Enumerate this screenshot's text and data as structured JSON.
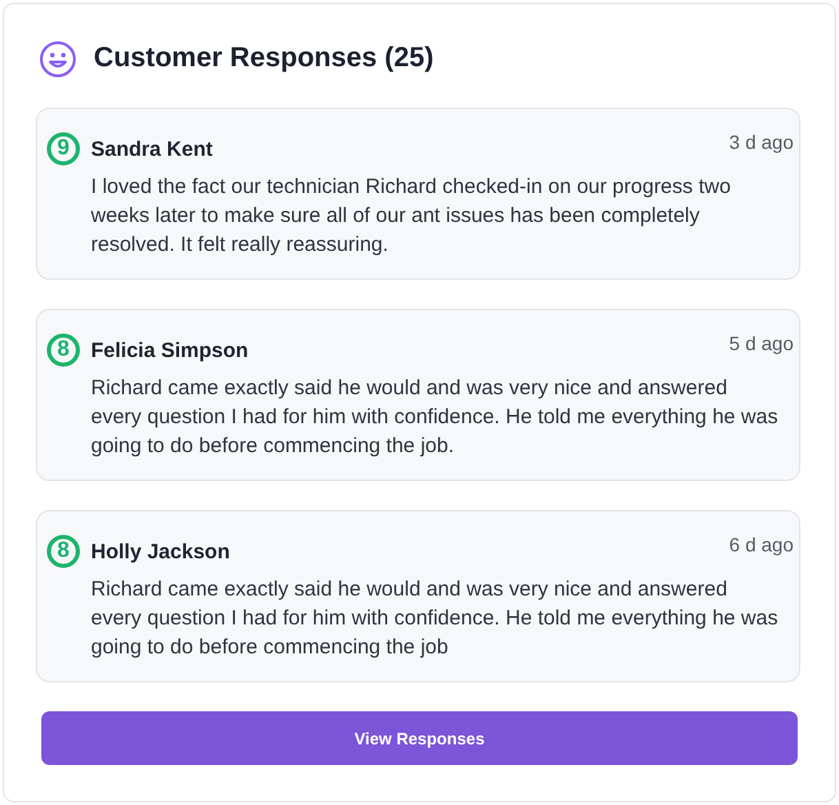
{
  "header": {
    "title": "Customer Responses (25)"
  },
  "responses": [
    {
      "score": "9",
      "name": "Sandra Kent",
      "time": "3 d ago",
      "text": "I loved the fact our technician Richard checked-in on our progress two weeks later to make sure all of our ant issues has been completely resolved. It felt really reassuring."
    },
    {
      "score": "8",
      "name": "Felicia Simpson",
      "time": "5 d ago",
      "text": "Richard came exactly said he would and was very nice and answered every question I had for him with confidence. He told me everything he was going to do before commencing the job."
    },
    {
      "score": "8",
      "name": "Holly Jackson",
      "time": "6 d ago",
      "text": "Richard came exactly said he would and was very nice and answered every question I had for him with confidence. He told me everything he was going to do before commencing the job"
    }
  ],
  "button": {
    "label": "View Responses"
  }
}
